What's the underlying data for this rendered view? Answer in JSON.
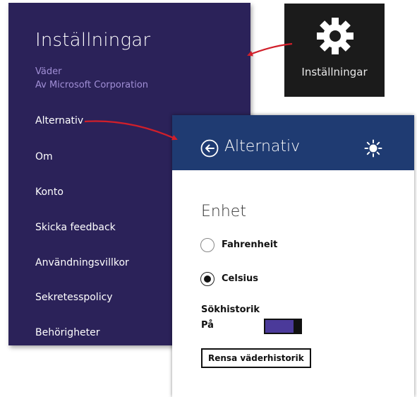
{
  "settings_panel": {
    "title": "Inställningar",
    "app_name": "Väder",
    "app_publisher": "Av Microsoft Corporation",
    "items": [
      {
        "label": "Alternativ"
      },
      {
        "label": "Om"
      },
      {
        "label": "Konto"
      },
      {
        "label": "Skicka feedback"
      },
      {
        "label": "Användningsvillkor"
      },
      {
        "label": "Sekretesspolicy"
      },
      {
        "label": "Behörigheter"
      }
    ]
  },
  "charm": {
    "icon": "gear-icon",
    "label": "Inställningar"
  },
  "options_panel": {
    "title": "Alternativ",
    "back_icon": "back-arrow-icon",
    "header_icon": "sun-icon",
    "unit_heading": "Enhet",
    "units": [
      {
        "label": "Fahrenheit",
        "checked": false
      },
      {
        "label": "Celsius",
        "checked": true
      }
    ],
    "search_history_label": "Sökhistorik",
    "search_history_state": "På",
    "clear_button_label": "Rensa väderhistorik"
  },
  "colors": {
    "settings_bg": "#2b2259",
    "settings_subtext": "#a18fd6",
    "charm_bg": "#1b1b1b",
    "options_header_bg": "#1f3b72",
    "toggle_fill": "#4b3a9a",
    "annotation_arrow": "#d11f2a"
  }
}
